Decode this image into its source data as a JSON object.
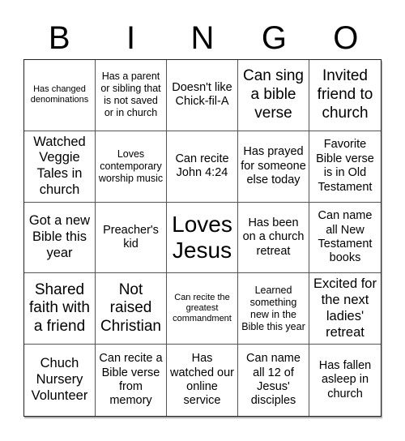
{
  "header": {
    "letters": [
      "B",
      "I",
      "N",
      "G",
      "O"
    ]
  },
  "board": {
    "rows": [
      [
        "Has changed denominations",
        "Has a parent or sibling that is not saved or in church",
        "Doesn't like Chick-fil-A",
        "Can sing a bible verse",
        "Invited friend to church"
      ],
      [
        "Watched Veggie Tales in church",
        "Loves contemporary worship music",
        "Can recite John 4:24",
        "Has prayed for someone else today",
        "Favorite Bible verse is in Old Testament"
      ],
      [
        "Got a new Bible this year",
        "Preacher's kid",
        "Loves Jesus",
        "Has been on a church retreat",
        "Can name all New Testament books"
      ],
      [
        "Shared faith with a friend",
        "Not raised Christian",
        "Can recite the greatest commandment",
        "Learned something new in the Bible this year",
        "Excited for the next ladies' retreat"
      ],
      [
        "Chuch Nursery Volunteer",
        "Can recite a Bible verse from memory",
        "Has watched our online service",
        "Can name all 12 of Jesus' disciples",
        "Has fallen asleep in church"
      ]
    ],
    "free_space": "Loves Jesus"
  },
  "colors": {
    "background": "#ffffff",
    "text": "#000000",
    "grid_line": "#555555"
  }
}
